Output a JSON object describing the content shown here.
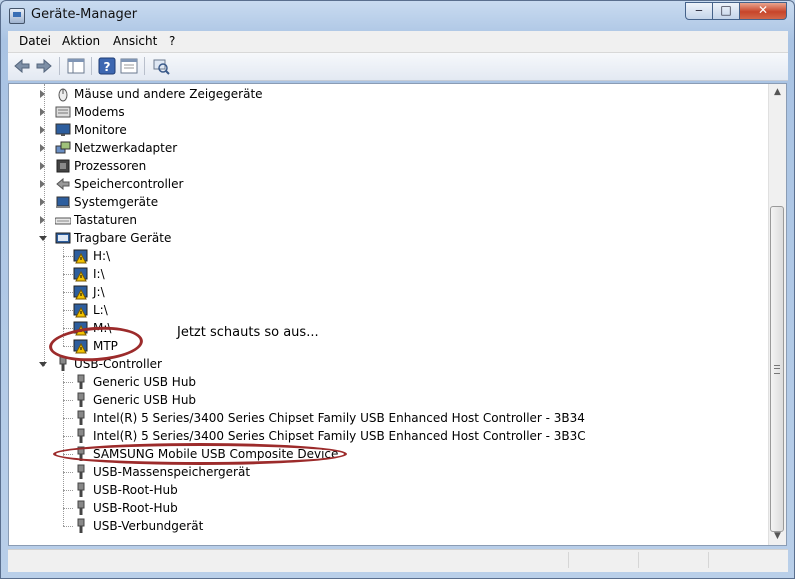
{
  "window": {
    "title": "Geräte-Manager",
    "min_glyph": "‒",
    "max_glyph": "□",
    "close_glyph": "✕"
  },
  "menu": [
    "Datei",
    "Aktion",
    "Ansicht",
    "?"
  ],
  "tree": {
    "categories_top": [
      {
        "label": "Mäuse und andere Zeigegeräte",
        "icon": "mouse-icon"
      },
      {
        "label": "Modems",
        "icon": "modem-icon"
      },
      {
        "label": "Monitore",
        "icon": "monitor-icon"
      },
      {
        "label": "Netzwerkadapter",
        "icon": "network-adapter-icon"
      },
      {
        "label": "Prozessoren",
        "icon": "processor-icon"
      },
      {
        "label": "Speichercontroller",
        "icon": "storage-controller-icon"
      },
      {
        "label": "Systemgeräte",
        "icon": "system-device-icon"
      },
      {
        "label": "Tastaturen",
        "icon": "keyboard-icon"
      }
    ],
    "portable": {
      "label": "Tragbare Geräte",
      "children": [
        "H:\\",
        "I:\\",
        "J:\\",
        "L:\\",
        "M:\\",
        "MTP"
      ]
    },
    "usb": {
      "label": "USB-Controller",
      "children": [
        "Generic USB Hub",
        "Generic USB Hub",
        "Intel(R) 5 Series/3400 Series Chipset Family USB Enhanced Host Controller - 3B34",
        "Intel(R) 5 Series/3400 Series Chipset Family USB Enhanced Host Controller - 3B3C",
        "SAMSUNG Mobile USB Composite Device",
        "USB-Massenspeichergerät",
        "USB-Root-Hub",
        "USB-Root-Hub",
        "USB-Verbundgerät"
      ]
    }
  },
  "annotation": {
    "text": "Jetzt schauts so aus...",
    "color": "#9c2b2b"
  },
  "colors": {
    "warning": "#f2c200",
    "device_blue": "#2d5e9e"
  }
}
